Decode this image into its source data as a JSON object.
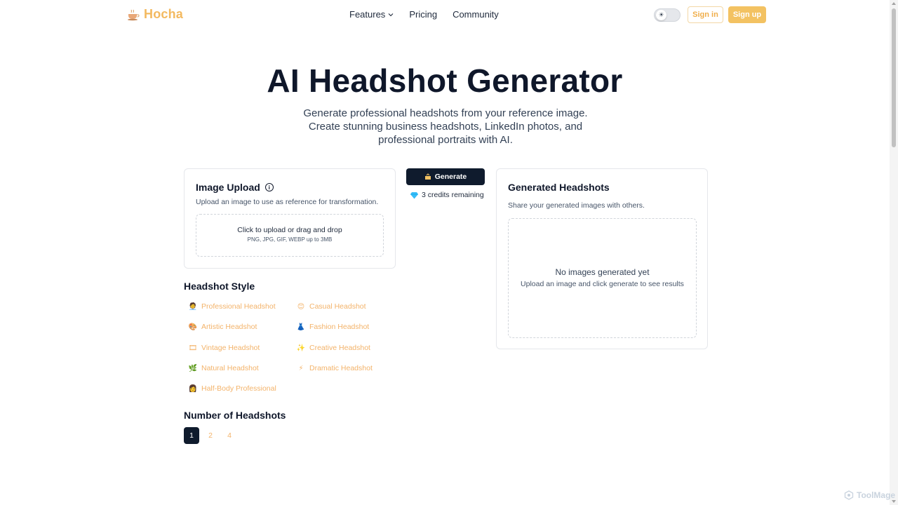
{
  "nav": {
    "brand": "Hocha",
    "links": [
      "Features",
      "Pricing",
      "Community"
    ],
    "sign_in": "Sign in",
    "sign_up": "Sign up"
  },
  "hero": {
    "title": "AI Headshot Generator",
    "subtitle": "Generate professional headshots from your reference image. Create stunning business headshots, LinkedIn photos, and professional portraits with AI."
  },
  "upload": {
    "title": "Image Upload",
    "description": "Upload an image to use as reference for transformation.",
    "drop_main": "Click to upload or drag and drop",
    "drop_sub": "PNG, JPG, GIF, WEBP up to 3MB"
  },
  "generate": {
    "button": "Generate",
    "credits": "3 credits remaining"
  },
  "results": {
    "title": "Generated Headshots",
    "description": "Share your generated images with others.",
    "empty_main": "No images generated yet",
    "empty_sub": "Upload an image and click generate to see results"
  },
  "styles": {
    "title": "Headshot Style",
    "items": [
      {
        "label": "Professional Headshot",
        "icon": "briefcase-person-icon"
      },
      {
        "label": "Casual Headshot",
        "icon": "smile-icon"
      },
      {
        "label": "Artistic Headshot",
        "icon": "palette-icon"
      },
      {
        "label": "Fashion Headshot",
        "icon": "dress-icon"
      },
      {
        "label": "Vintage Headshot",
        "icon": "film-icon"
      },
      {
        "label": "Creative Headshot",
        "icon": "sparkles-icon"
      },
      {
        "label": "Natural Headshot",
        "icon": "leaf-icon"
      },
      {
        "label": "Dramatic Headshot",
        "icon": "lightning-icon"
      },
      {
        "label": "Half-Body Professional",
        "icon": "person-icon"
      }
    ]
  },
  "count": {
    "title": "Number of Headshots",
    "options": [
      "1",
      "2",
      "4"
    ],
    "selected": "1"
  },
  "watermark": "ToolMage",
  "colors": {
    "brand": "#f3b95f",
    "dark": "#0f1b2d",
    "link": "#f3b36a"
  }
}
